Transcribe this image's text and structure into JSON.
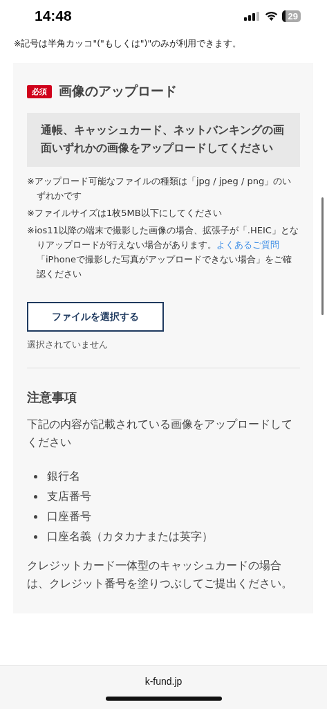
{
  "status_bar": {
    "time": "14:48",
    "battery": "29"
  },
  "top_note": "※記号は半角カッコ\"(\"もしくは\")\"のみが利用できます。",
  "upload": {
    "badge": "必須",
    "title": "画像のアップロード",
    "instruction": "通帳、キャッシュカード、ネットバンキングの画面いずれかの画像をアップロードしてください",
    "notes": [
      {
        "text": "※アップロード可能なファイルの種類は「jpg / jpeg / png」のいずれかです"
      },
      {
        "text": "※ファイルサイズは1枚5MB以下にしてください"
      },
      {
        "text": "※ios11以降の端末で撮影した画像の場合、拡張子が「.HEIC」となりアップロードが行えない場合があります。",
        "link": "よくあるご質問",
        "after": "「iPhoneで撮影した写真がアップロードできない場合」をご確認ください"
      }
    ],
    "button": "ファイルを選択する",
    "file_status": "選択されていません"
  },
  "caution": {
    "title": "注意事項",
    "intro": "下記の内容が記載されている画像をアップロードしてください",
    "items": [
      "銀行名",
      "支店番号",
      "口座番号",
      "口座名義（カタカナまたは英字）"
    ],
    "footer": "クレジットカード一体型のキャッシュカードの場合は、クレジット番号を塗りつぶしてご提出ください。"
  },
  "address_bar": {
    "url": "k-fund.jp"
  }
}
